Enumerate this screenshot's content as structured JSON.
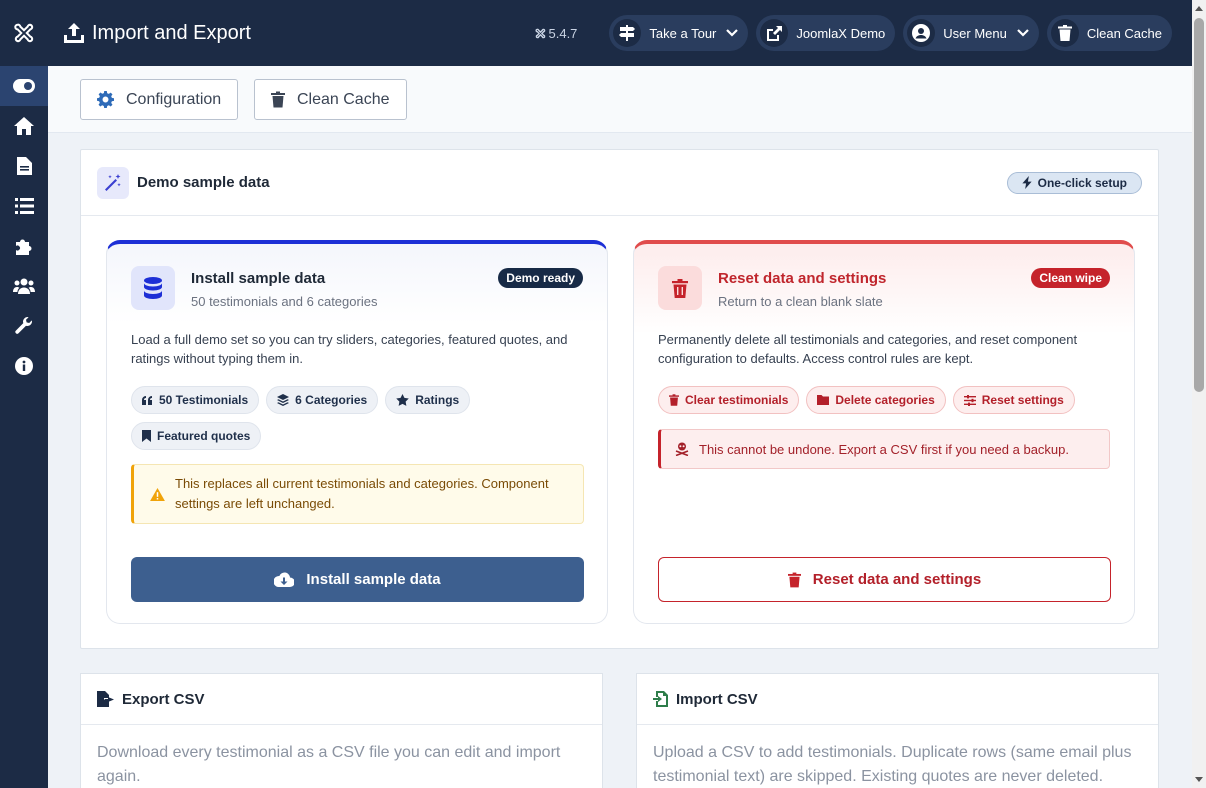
{
  "header": {
    "title": "Import and Export",
    "version": "5.4.7",
    "buttons": [
      {
        "label": "Take a Tour"
      },
      {
        "label": "JoomlaX Demo"
      },
      {
        "label": "User Menu"
      },
      {
        "label": "Clean Cache"
      }
    ]
  },
  "sidebar": {
    "items": [
      "toggle-icon",
      "home-icon",
      "file-icon",
      "list-icon",
      "puzzle-icon",
      "users-icon",
      "wrench-icon",
      "info-icon"
    ]
  },
  "toolbar": {
    "configuration_label": "Configuration",
    "clean_cache_label": "Clean Cache"
  },
  "demo": {
    "title": "Demo sample data",
    "pill": "One-click setup",
    "install": {
      "title": "Install sample data",
      "subtitle": "50 testimonials and 6 categories",
      "badge": "Demo ready",
      "description": "Load a full demo set so you can try sliders, categories, featured quotes, and ratings without typing them in.",
      "chips": [
        "50 Testimonials",
        "6 Categories",
        "Ratings",
        "Featured quotes"
      ],
      "warning": "This replaces all current testimonials and categories. Component settings are left unchanged.",
      "button": "Install sample data"
    },
    "reset": {
      "title": "Reset data and settings",
      "subtitle": "Return to a clean blank slate",
      "badge": "Clean wipe",
      "description": "Permanently delete all testimonials and categories, and reset component configuration to defaults. Access control rules are kept.",
      "chips": [
        "Clear testimonials",
        "Delete categories",
        "Reset settings"
      ],
      "danger": "This cannot be undone. Export a CSV first if you need a backup.",
      "button": "Reset data and settings"
    }
  },
  "export": {
    "title": "Export CSV",
    "description": "Download every testimonial as a CSV file you can edit and import again."
  },
  "import": {
    "title": "Import CSV",
    "description": "Upload a CSV to add testimonials. Duplicate rows (same email plus testimonial text) are skipped. Existing quotes are never deleted."
  },
  "colors": {
    "navy": "#1c2b45",
    "primary_button": "#3d5f8f",
    "danger": "#c5232b",
    "accent_blue": "#1d2fd6"
  }
}
